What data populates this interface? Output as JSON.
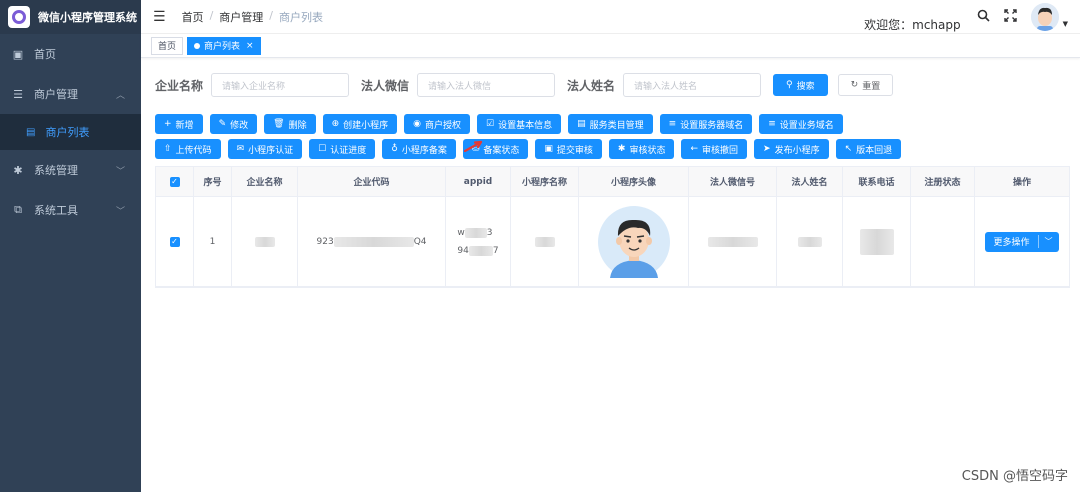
{
  "brand": {
    "title": "微信小程序管理系统"
  },
  "sidebar": {
    "items": [
      {
        "label": "首页",
        "icon": "dashboard-icon"
      },
      {
        "label": "商户管理",
        "icon": "merchant-icon",
        "expanded": true,
        "children": [
          {
            "label": "商户列表",
            "icon": "list-icon",
            "active": true
          }
        ]
      },
      {
        "label": "系统管理",
        "icon": "gear-icon"
      },
      {
        "label": "系统工具",
        "icon": "toolbox-icon"
      }
    ]
  },
  "header": {
    "breadcrumb": [
      "首页",
      "商户管理",
      "商户列表"
    ],
    "welcome": "欢迎您：mchapp"
  },
  "tags": [
    {
      "label": "首页",
      "active": false
    },
    {
      "label": "商户列表",
      "active": true
    }
  ],
  "search": {
    "fields": [
      {
        "label": "企业名称",
        "placeholder": "请输入企业名称"
      },
      {
        "label": "法人微信",
        "placeholder": "请输入法人微信"
      },
      {
        "label": "法人姓名",
        "placeholder": "请输入法人姓名"
      }
    ],
    "search_label": "搜索",
    "reset_label": "重置"
  },
  "toolbar_row1": [
    {
      "label": "新增",
      "icon": "+"
    },
    {
      "label": "修改",
      "icon": "✎"
    },
    {
      "label": "删除",
      "icon": "🗑"
    },
    {
      "label": "创建小程序",
      "icon": "⊕"
    },
    {
      "label": "商户授权",
      "icon": "◉"
    },
    {
      "label": "设置基本信息",
      "icon": "☑"
    },
    {
      "label": "服务类目管理",
      "icon": "▤"
    },
    {
      "label": "设置服务器域名",
      "icon": "≡"
    },
    {
      "label": "设置业务域名",
      "icon": "≡"
    }
  ],
  "toolbar_row2": [
    {
      "label": "上传代码",
      "icon": "⇧"
    },
    {
      "label": "小程序认证",
      "icon": "✉"
    },
    {
      "label": "认证进度",
      "icon": "☐"
    },
    {
      "label": "小程序备案",
      "icon": "♁"
    },
    {
      "label": "备案状态",
      "icon": "⛁"
    },
    {
      "label": "提交审核",
      "icon": "▣"
    },
    {
      "label": "审核状态",
      "icon": "✱"
    },
    {
      "label": "审核撤回",
      "icon": "←"
    },
    {
      "label": "发布小程序",
      "icon": "➤"
    },
    {
      "label": "版本回退",
      "icon": "↖"
    }
  ],
  "table": {
    "columns": [
      "序号",
      "企业名称",
      "企业代码",
      "appid",
      "小程序名称",
      "小程序头像",
      "法人微信号",
      "法人姓名",
      "联系电话",
      "注册状态",
      "操作"
    ],
    "rows": [
      {
        "index": "1",
        "code_prefix": "923",
        "code_suffix": "Q4",
        "appid_line1_prefix": "w",
        "appid_line1_suffix": "3",
        "appid_line2_prefix": "94",
        "appid_line2_suffix": "7",
        "action_label": "更多操作"
      }
    ]
  },
  "watermark": "CSDN @悟空码字",
  "colors": {
    "primary": "#1890ff",
    "sidebar": "#304156"
  }
}
